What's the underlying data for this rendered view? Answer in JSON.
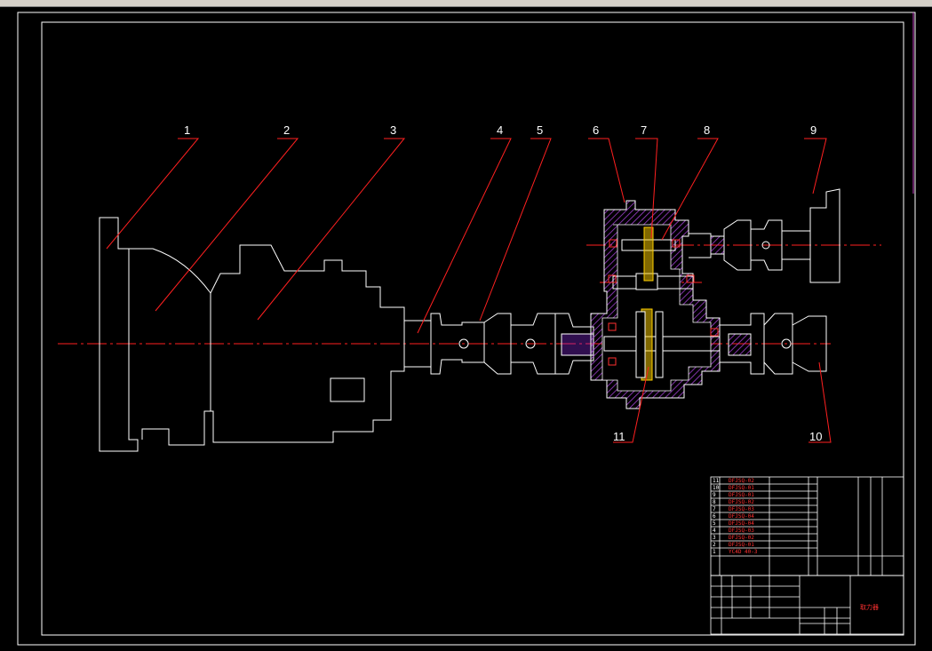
{
  "drawing": {
    "title": "取力器",
    "callouts": [
      "1",
      "2",
      "3",
      "4",
      "5",
      "6",
      "7",
      "8",
      "9",
      "10",
      "11"
    ],
    "bom": [
      {
        "no": "11",
        "code": "DFJSQ-02"
      },
      {
        "no": "10",
        "code": "DFJSQ-01"
      },
      {
        "no": "9",
        "code": "DFJSQ-01"
      },
      {
        "no": "8",
        "code": "DFJSQ-02"
      },
      {
        "no": "7",
        "code": "DFJSQ-03"
      },
      {
        "no": "6",
        "code": "DFJSQ-04"
      },
      {
        "no": "5",
        "code": "DFJSQ-04"
      },
      {
        "no": "4",
        "code": "DFJSQ-03"
      },
      {
        "no": "3",
        "code": "DFJSQ-02"
      },
      {
        "no": "2",
        "code": "DFJSQ-01"
      },
      {
        "no": "1",
        "code": "YC4D 40-3"
      }
    ],
    "colors": {
      "background": "#000000",
      "outline": "#ffffff",
      "centerline": "#ff2020",
      "hatch": "#8a2be2",
      "gear": "#ffd000"
    }
  }
}
